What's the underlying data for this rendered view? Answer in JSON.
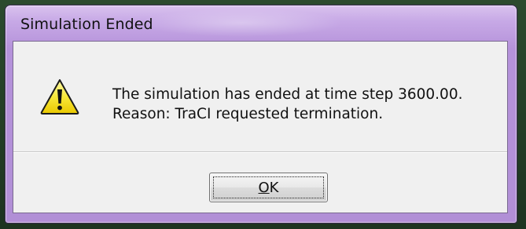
{
  "dialog": {
    "title": "Simulation Ended",
    "icon": "warning-icon",
    "message_line1": "The simulation has ended at time step 3600.00.",
    "message_line2": "Reason: TraCI requested termination.",
    "ok_button": {
      "mnemonic": "O",
      "rest": "K"
    }
  },
  "colors": {
    "titlebar": "#c7a9e6",
    "client_background": "#f0f0f0",
    "warning_yellow": "#f7e52a"
  }
}
